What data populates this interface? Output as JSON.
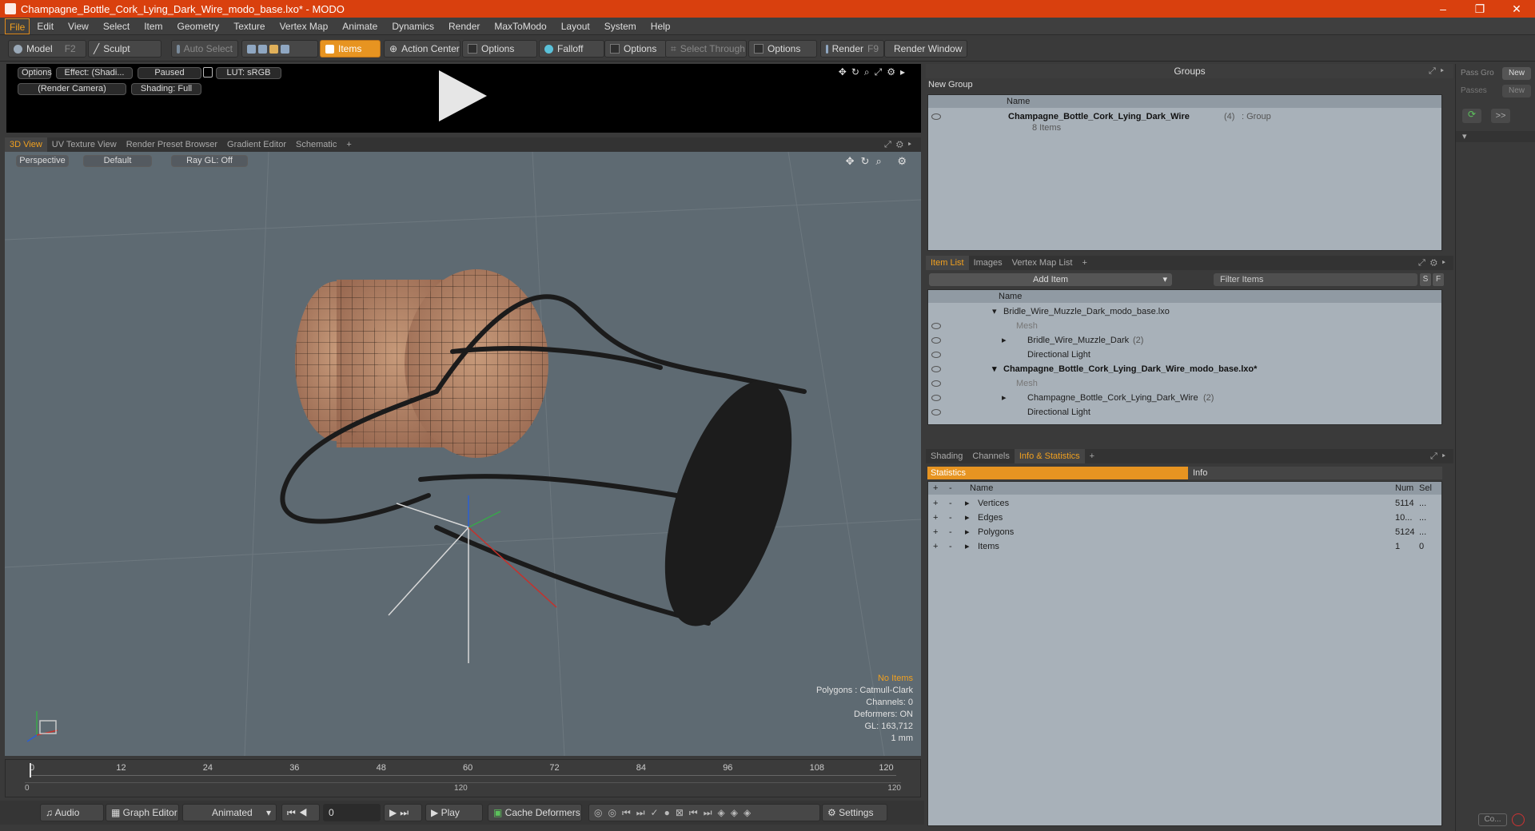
{
  "window": {
    "title": "Champagne_Bottle_Cork_Lying_Dark_Wire_modo_base.lxo* - MODO",
    "minimize": "–",
    "maximize": "❐",
    "close": "✕"
  },
  "menu": [
    "File",
    "Edit",
    "View",
    "Select",
    "Item",
    "Geometry",
    "Texture",
    "Vertex Map",
    "Animate",
    "Dynamics",
    "Render",
    "MaxToModo",
    "Layout",
    "System",
    "Help"
  ],
  "toolbar": {
    "model": "Model",
    "model_key": "F2",
    "sculpt": "Sculpt",
    "auto_select": "Auto Select",
    "items": "Items",
    "action_center": "Action Center",
    "options1": "Options",
    "falloff": "Falloff",
    "options2": "Options",
    "select_through": "Select Through",
    "options3": "Options",
    "render": "Render",
    "render_key": "F9",
    "render_window": "Render Window"
  },
  "player": {
    "options": "Options",
    "effect": "Effect: (Shadi...",
    "paused": "Paused",
    "lut": "LUT: sRGB",
    "camera": "(Render Camera)",
    "shading": "Shading: Full"
  },
  "view_tabs": [
    "3D View",
    "UV Texture View",
    "Render Preset Browser",
    "Gradient Editor",
    "Schematic",
    "+"
  ],
  "viewport": {
    "perspective": "Perspective",
    "default": "Default",
    "raygl": "Ray GL: Off",
    "info": {
      "no_items": "No Items",
      "polygons": "Polygons : Catmull-Clark",
      "channels": "Channels: 0",
      "deformers": "Deformers: ON",
      "gl": "GL: 163,712",
      "unit": "1 mm"
    }
  },
  "timeline": {
    "ticks": [
      "0",
      "12",
      "24",
      "36",
      "48",
      "60",
      "72",
      "84",
      "96",
      "108",
      "120"
    ],
    "lower": [
      "0",
      "120",
      "120"
    ]
  },
  "bottom": {
    "audio": "Audio",
    "graph_editor": "Graph Editor",
    "animated": "Animated",
    "frame": "0",
    "play": "Play",
    "cache": "Cache Deformers",
    "settings": "Settings"
  },
  "groups": {
    "title": "Groups",
    "new_group": "New Group",
    "col_name": "Name",
    "item_name": "Champagne_Bottle_Cork_Lying_Dark_Wire",
    "item_count": "(4)",
    "item_type": ": Group",
    "item_sub": "8 Items"
  },
  "passes": {
    "pass_group": "Pass Gro",
    "passes": "Passes",
    "new1": "New",
    "new2": "New",
    "more": ">>",
    "bottom": "Co..."
  },
  "item_list": {
    "tabs": [
      "Item List",
      "Images",
      "Vertex Map List",
      "+"
    ],
    "add_item": "Add Item",
    "filter": "Filter Items",
    "s": "S",
    "f": "F",
    "col_name": "Name",
    "rows": [
      {
        "label": "Bridle_Wire_Muzzle_Dark_modo_base.lxo",
        "bold": false,
        "muted": false
      },
      {
        "label": "Mesh",
        "bold": false,
        "muted": true
      },
      {
        "label": "Bridle_Wire_Muzzle_Dark",
        "count": "(2)",
        "bold": false,
        "muted": false
      },
      {
        "label": "Directional Light",
        "bold": false,
        "muted": false
      },
      {
        "label": "Champagne_Bottle_Cork_Lying_Dark_Wire_modo_base.lxo*",
        "bold": true,
        "muted": false
      },
      {
        "label": "Mesh",
        "bold": false,
        "muted": true
      },
      {
        "label": "Champagne_Bottle_Cork_Lying_Dark_Wire",
        "count": "(2)",
        "bold": false,
        "muted": false
      },
      {
        "label": "Directional Light",
        "bold": false,
        "muted": false
      }
    ]
  },
  "stats": {
    "tabs": [
      "Shading",
      "Channels",
      "Info & Statistics",
      "+"
    ],
    "statistics": "Statistics",
    "info": "Info",
    "col_name": "Name",
    "col_num": "Num",
    "col_sel": "Sel",
    "rows": [
      {
        "name": "Vertices",
        "num": "5114",
        "sel": "..."
      },
      {
        "name": "Edges",
        "num": "10...",
        "sel": "..."
      },
      {
        "name": "Polygons",
        "num": "5124",
        "sel": "..."
      },
      {
        "name": "Items",
        "num": "1",
        "sel": "0"
      }
    ]
  },
  "colors": {
    "accent": "#e79421",
    "titlebar": "#d9400e",
    "panel": "#a8b1b9",
    "viewport": "#5e6a72"
  }
}
